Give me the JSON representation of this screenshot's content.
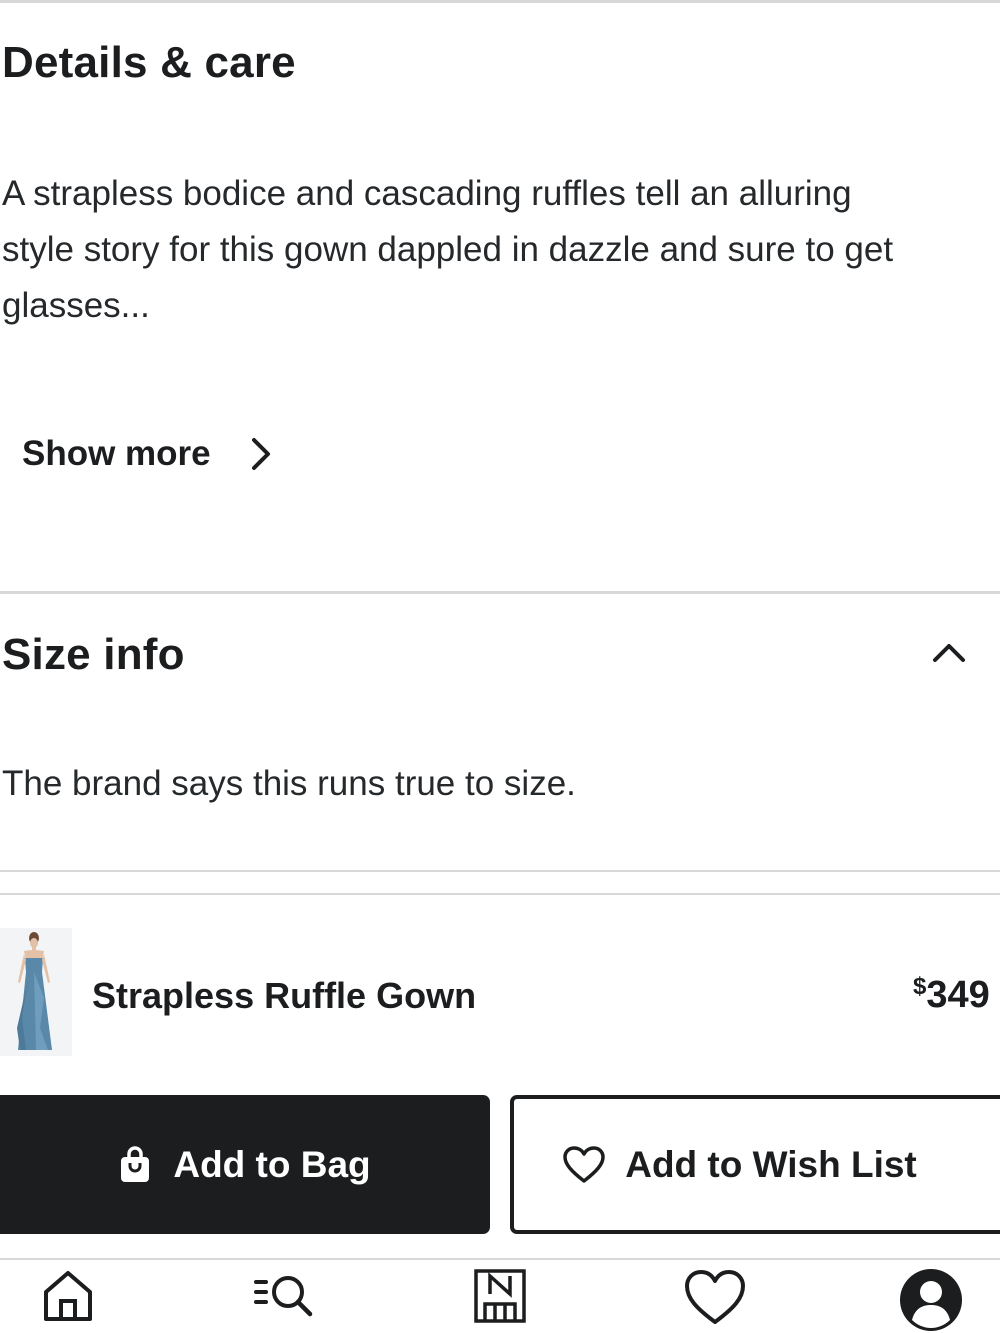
{
  "details": {
    "heading": "Details & care",
    "description_lines": [
      "A strapless bodice and cascading ruffles tell an alluring",
      "style story for this gown dappled in dazzle and sure to get",
      "glasses..."
    ],
    "show_more_label": "Show more"
  },
  "size_info": {
    "heading": "Size info",
    "text": "The brand says this runs true to size."
  },
  "product": {
    "name": "Strapless Ruffle Gown",
    "price_currency": "$",
    "price_value": "349"
  },
  "actions": {
    "add_to_bag_label": "Add to Bag",
    "add_to_wish_list_label": "Add to Wish List"
  },
  "tab_bar": {
    "items": [
      {
        "icon": "home-icon"
      },
      {
        "icon": "browse-search-icon"
      },
      {
        "icon": "nordstrom-store-icon"
      },
      {
        "icon": "heart-icon"
      },
      {
        "icon": "account-icon"
      }
    ]
  },
  "colors": {
    "text": "#1b1d1f",
    "primary_button": "#1b1d1f",
    "divider": "#d6d8da",
    "gown": "#5a88a8"
  }
}
